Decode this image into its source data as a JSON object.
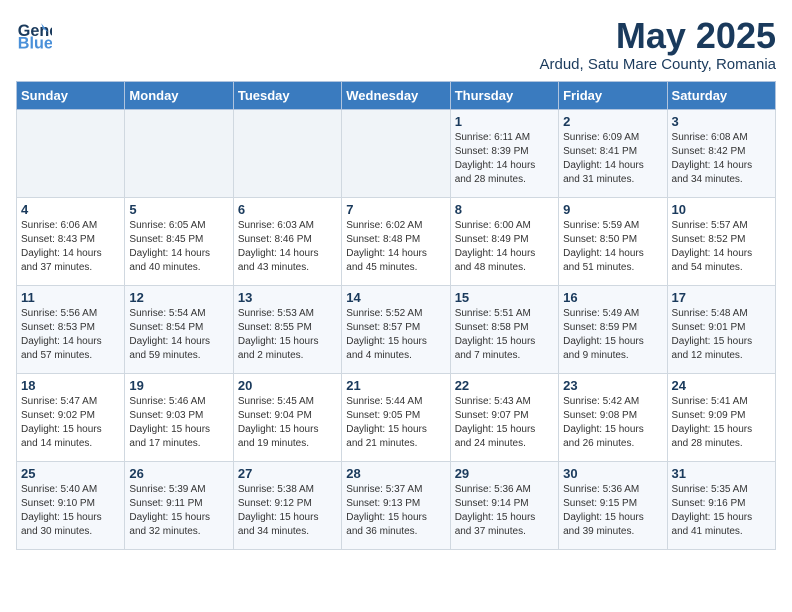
{
  "header": {
    "logo_line1": "General",
    "logo_line2": "Blue",
    "title": "May 2025",
    "subtitle": "Ardud, Satu Mare County, Romania"
  },
  "days_of_week": [
    "Sunday",
    "Monday",
    "Tuesday",
    "Wednesday",
    "Thursday",
    "Friday",
    "Saturday"
  ],
  "weeks": [
    [
      {
        "num": "",
        "info": ""
      },
      {
        "num": "",
        "info": ""
      },
      {
        "num": "",
        "info": ""
      },
      {
        "num": "",
        "info": ""
      },
      {
        "num": "1",
        "info": "Sunrise: 6:11 AM\nSunset: 8:39 PM\nDaylight: 14 hours\nand 28 minutes."
      },
      {
        "num": "2",
        "info": "Sunrise: 6:09 AM\nSunset: 8:41 PM\nDaylight: 14 hours\nand 31 minutes."
      },
      {
        "num": "3",
        "info": "Sunrise: 6:08 AM\nSunset: 8:42 PM\nDaylight: 14 hours\nand 34 minutes."
      }
    ],
    [
      {
        "num": "4",
        "info": "Sunrise: 6:06 AM\nSunset: 8:43 PM\nDaylight: 14 hours\nand 37 minutes."
      },
      {
        "num": "5",
        "info": "Sunrise: 6:05 AM\nSunset: 8:45 PM\nDaylight: 14 hours\nand 40 minutes."
      },
      {
        "num": "6",
        "info": "Sunrise: 6:03 AM\nSunset: 8:46 PM\nDaylight: 14 hours\nand 43 minutes."
      },
      {
        "num": "7",
        "info": "Sunrise: 6:02 AM\nSunset: 8:48 PM\nDaylight: 14 hours\nand 45 minutes."
      },
      {
        "num": "8",
        "info": "Sunrise: 6:00 AM\nSunset: 8:49 PM\nDaylight: 14 hours\nand 48 minutes."
      },
      {
        "num": "9",
        "info": "Sunrise: 5:59 AM\nSunset: 8:50 PM\nDaylight: 14 hours\nand 51 minutes."
      },
      {
        "num": "10",
        "info": "Sunrise: 5:57 AM\nSunset: 8:52 PM\nDaylight: 14 hours\nand 54 minutes."
      }
    ],
    [
      {
        "num": "11",
        "info": "Sunrise: 5:56 AM\nSunset: 8:53 PM\nDaylight: 14 hours\nand 57 minutes."
      },
      {
        "num": "12",
        "info": "Sunrise: 5:54 AM\nSunset: 8:54 PM\nDaylight: 14 hours\nand 59 minutes."
      },
      {
        "num": "13",
        "info": "Sunrise: 5:53 AM\nSunset: 8:55 PM\nDaylight: 15 hours\nand 2 minutes."
      },
      {
        "num": "14",
        "info": "Sunrise: 5:52 AM\nSunset: 8:57 PM\nDaylight: 15 hours\nand 4 minutes."
      },
      {
        "num": "15",
        "info": "Sunrise: 5:51 AM\nSunset: 8:58 PM\nDaylight: 15 hours\nand 7 minutes."
      },
      {
        "num": "16",
        "info": "Sunrise: 5:49 AM\nSunset: 8:59 PM\nDaylight: 15 hours\nand 9 minutes."
      },
      {
        "num": "17",
        "info": "Sunrise: 5:48 AM\nSunset: 9:01 PM\nDaylight: 15 hours\nand 12 minutes."
      }
    ],
    [
      {
        "num": "18",
        "info": "Sunrise: 5:47 AM\nSunset: 9:02 PM\nDaylight: 15 hours\nand 14 minutes."
      },
      {
        "num": "19",
        "info": "Sunrise: 5:46 AM\nSunset: 9:03 PM\nDaylight: 15 hours\nand 17 minutes."
      },
      {
        "num": "20",
        "info": "Sunrise: 5:45 AM\nSunset: 9:04 PM\nDaylight: 15 hours\nand 19 minutes."
      },
      {
        "num": "21",
        "info": "Sunrise: 5:44 AM\nSunset: 9:05 PM\nDaylight: 15 hours\nand 21 minutes."
      },
      {
        "num": "22",
        "info": "Sunrise: 5:43 AM\nSunset: 9:07 PM\nDaylight: 15 hours\nand 24 minutes."
      },
      {
        "num": "23",
        "info": "Sunrise: 5:42 AM\nSunset: 9:08 PM\nDaylight: 15 hours\nand 26 minutes."
      },
      {
        "num": "24",
        "info": "Sunrise: 5:41 AM\nSunset: 9:09 PM\nDaylight: 15 hours\nand 28 minutes."
      }
    ],
    [
      {
        "num": "25",
        "info": "Sunrise: 5:40 AM\nSunset: 9:10 PM\nDaylight: 15 hours\nand 30 minutes."
      },
      {
        "num": "26",
        "info": "Sunrise: 5:39 AM\nSunset: 9:11 PM\nDaylight: 15 hours\nand 32 minutes."
      },
      {
        "num": "27",
        "info": "Sunrise: 5:38 AM\nSunset: 9:12 PM\nDaylight: 15 hours\nand 34 minutes."
      },
      {
        "num": "28",
        "info": "Sunrise: 5:37 AM\nSunset: 9:13 PM\nDaylight: 15 hours\nand 36 minutes."
      },
      {
        "num": "29",
        "info": "Sunrise: 5:36 AM\nSunset: 9:14 PM\nDaylight: 15 hours\nand 37 minutes."
      },
      {
        "num": "30",
        "info": "Sunrise: 5:36 AM\nSunset: 9:15 PM\nDaylight: 15 hours\nand 39 minutes."
      },
      {
        "num": "31",
        "info": "Sunrise: 5:35 AM\nSunset: 9:16 PM\nDaylight: 15 hours\nand 41 minutes."
      }
    ]
  ]
}
